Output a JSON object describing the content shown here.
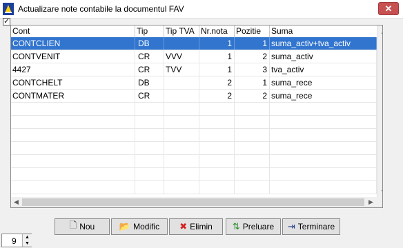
{
  "window": {
    "title": "Actualizare note contabile la documentul FAV",
    "close_glyph": "✕"
  },
  "checkbox": {
    "checked": true,
    "glyph": "✓"
  },
  "table": {
    "columns": [
      "Cont",
      "Tip",
      "Tip TVA",
      "Nr.nota",
      "Pozitie",
      "Suma"
    ],
    "rows": [
      {
        "cont": "CONTCLIEN",
        "tip": "DB",
        "tip_tva": "",
        "nr_nota": "1",
        "pozitie": "1",
        "suma": "suma_activ+tva_activ"
      },
      {
        "cont": "CONTVENIT",
        "tip": "CR",
        "tip_tva": "VVV",
        "nr_nota": "1",
        "pozitie": "2",
        "suma": "suma_activ"
      },
      {
        "cont": "4427",
        "tip": "CR",
        "tip_tva": "TVV",
        "nr_nota": "1",
        "pozitie": "3",
        "suma": "tva_activ"
      },
      {
        "cont": "CONTCHELT",
        "tip": "DB",
        "tip_tva": "",
        "nr_nota": "2",
        "pozitie": "1",
        "suma": "suma_rece"
      },
      {
        "cont": "CONTMATER",
        "tip": "CR",
        "tip_tva": "",
        "nr_nota": "2",
        "pozitie": "2",
        "suma": "suma_rece"
      }
    ],
    "selected_row": 0
  },
  "buttons": [
    {
      "label": "Nou",
      "icon": "new-document-icon",
      "glyph": "🗋",
      "color": "#444444"
    },
    {
      "label": "Modific",
      "icon": "folder-open-icon",
      "glyph": "📂",
      "color": "#c8961e"
    },
    {
      "label": "Elimin",
      "icon": "delete-x-icon",
      "glyph": "✖",
      "color": "#d42020"
    },
    {
      "label": "Preluare",
      "icon": "import-icon",
      "glyph": "⇅",
      "color": "#2a8a2a"
    },
    {
      "label": "Terminare",
      "icon": "exit-door-icon",
      "glyph": "⇥",
      "color": "#1e3c8a"
    }
  ],
  "spinner": {
    "value": "9"
  },
  "colors": {
    "selection": "#3175ce",
    "close": "#c75050"
  }
}
